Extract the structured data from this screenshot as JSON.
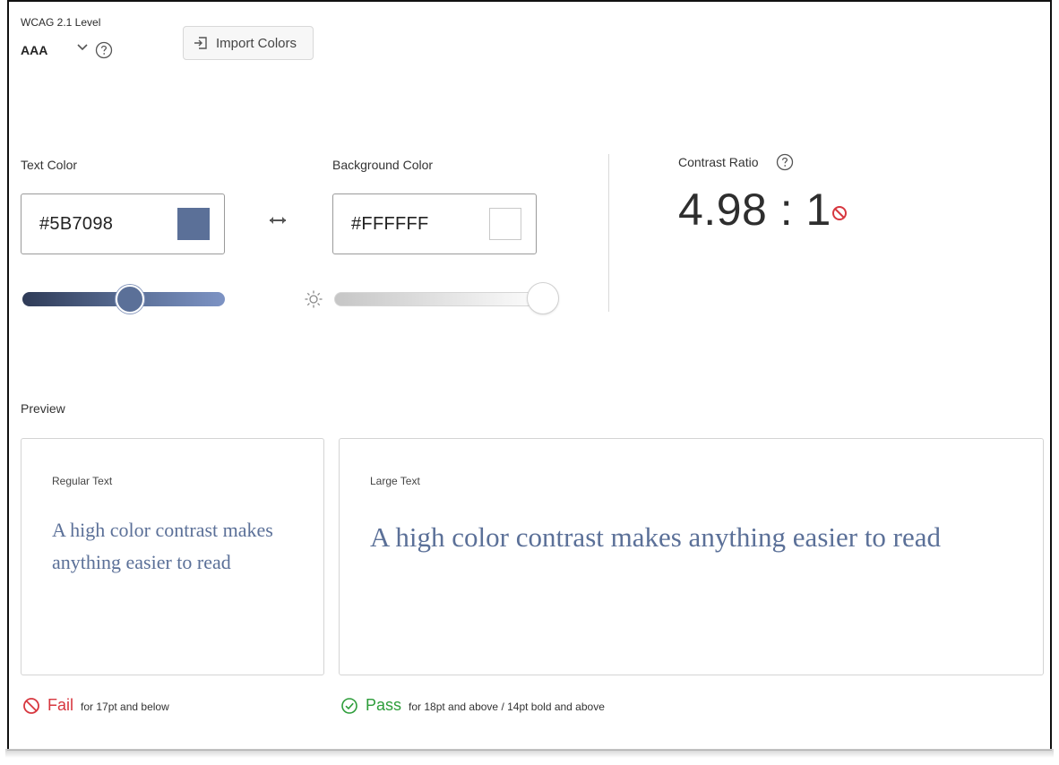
{
  "wcag": {
    "label": "WCAG 2.1 Level",
    "value": "AAA"
  },
  "import_button": {
    "label": "Import Colors"
  },
  "text_color": {
    "label": "Text Color",
    "hex": "#5B7098"
  },
  "background_color": {
    "label": "Background Color",
    "hex": "#FFFFFF"
  },
  "contrast": {
    "label": "Contrast Ratio",
    "value": "4.98 : 1"
  },
  "preview": {
    "label": "Preview",
    "regular": {
      "title": "Regular Text",
      "sample": "A high color contrast makes anything easier to read"
    },
    "large": {
      "title": "Large Text",
      "sample": "A high color contrast makes anything easier to read"
    }
  },
  "results": {
    "regular": {
      "status": "Fail",
      "note": "for 17pt and below"
    },
    "large": {
      "status": "Pass",
      "note": "for 18pt and above / 14pt bold and above"
    }
  },
  "colors": {
    "text": "#5B7098",
    "background": "#FFFFFF",
    "fail": "#d7373f",
    "pass": "#2d9d3a"
  },
  "icons": {
    "chevron": "chevron-down-icon",
    "help": "help-icon",
    "import": "import-icon",
    "swap": "swap-icon",
    "brightness": "sun-icon",
    "fail": "fail-icon",
    "pass": "pass-icon"
  }
}
